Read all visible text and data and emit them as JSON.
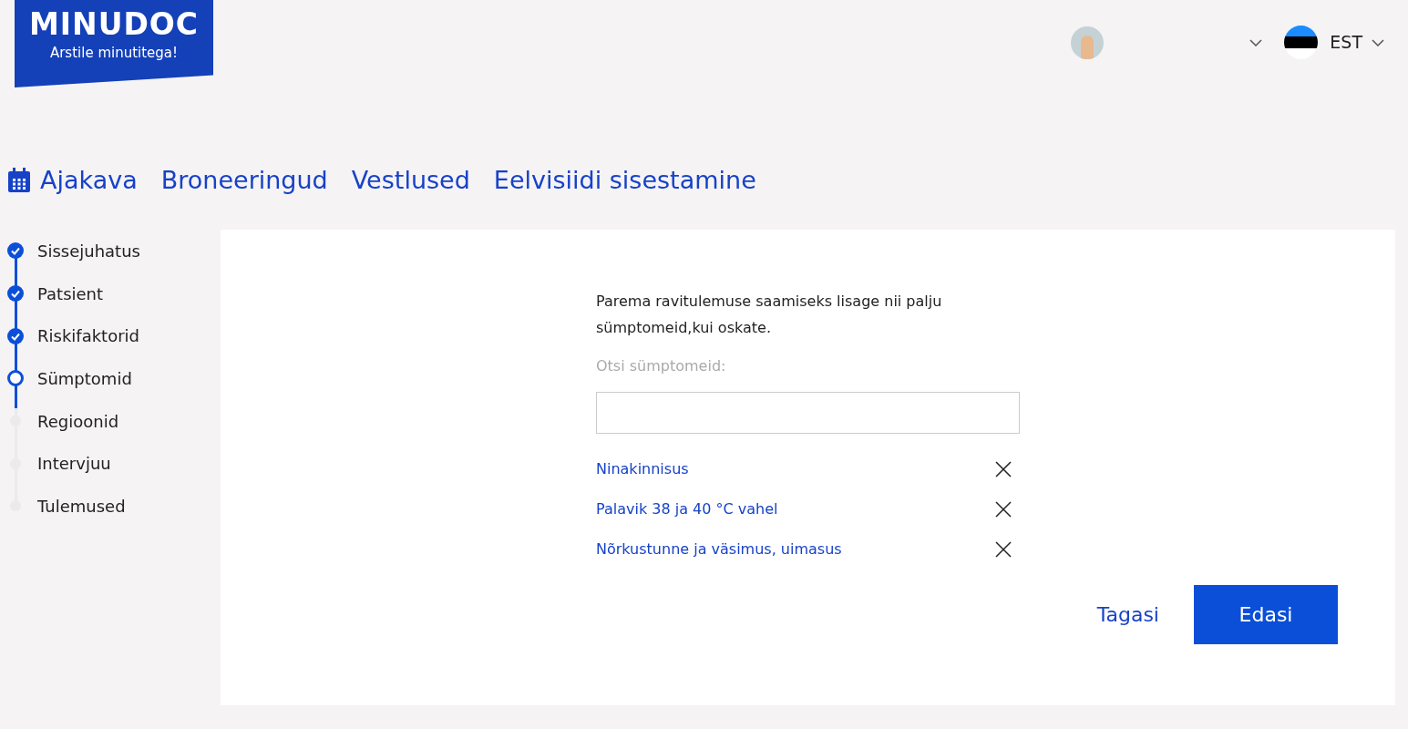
{
  "logo": {
    "name": "MINUDOC",
    "tagline": "Arstile minutitega!"
  },
  "language": {
    "code": "EST"
  },
  "nav": [
    {
      "label": "Ajakava",
      "kind": "calendar"
    },
    {
      "label": "Broneeringud",
      "kind": "plain"
    },
    {
      "label": "Vestlused",
      "kind": "plain"
    },
    {
      "label": "Eelvisiidi sisestamine",
      "kind": "plain"
    }
  ],
  "steps": [
    {
      "label": "Sissejuhatus",
      "kind": "done"
    },
    {
      "label": "Patsient",
      "kind": "done"
    },
    {
      "label": "Riskifaktorid",
      "kind": "done"
    },
    {
      "label": "Sümptomid",
      "kind": "current"
    },
    {
      "label": "Regioonid",
      "kind": "todo"
    },
    {
      "label": "Intervjuu",
      "kind": "todo"
    },
    {
      "label": "Tulemused",
      "kind": "todo"
    }
  ],
  "intro": "Parema ravitulemuse saamiseks lisage nii palju sümptomeid,kui oskate.",
  "search": {
    "label": "Otsi sümptomeid:"
  },
  "symptoms": [
    "Ninakinnisus",
    "Palavik 38 ja 40 °C vahel",
    "Nõrkustunne ja väsimus, uimasus"
  ],
  "buttons": {
    "back": "Tagasi",
    "next": "Edasi"
  }
}
